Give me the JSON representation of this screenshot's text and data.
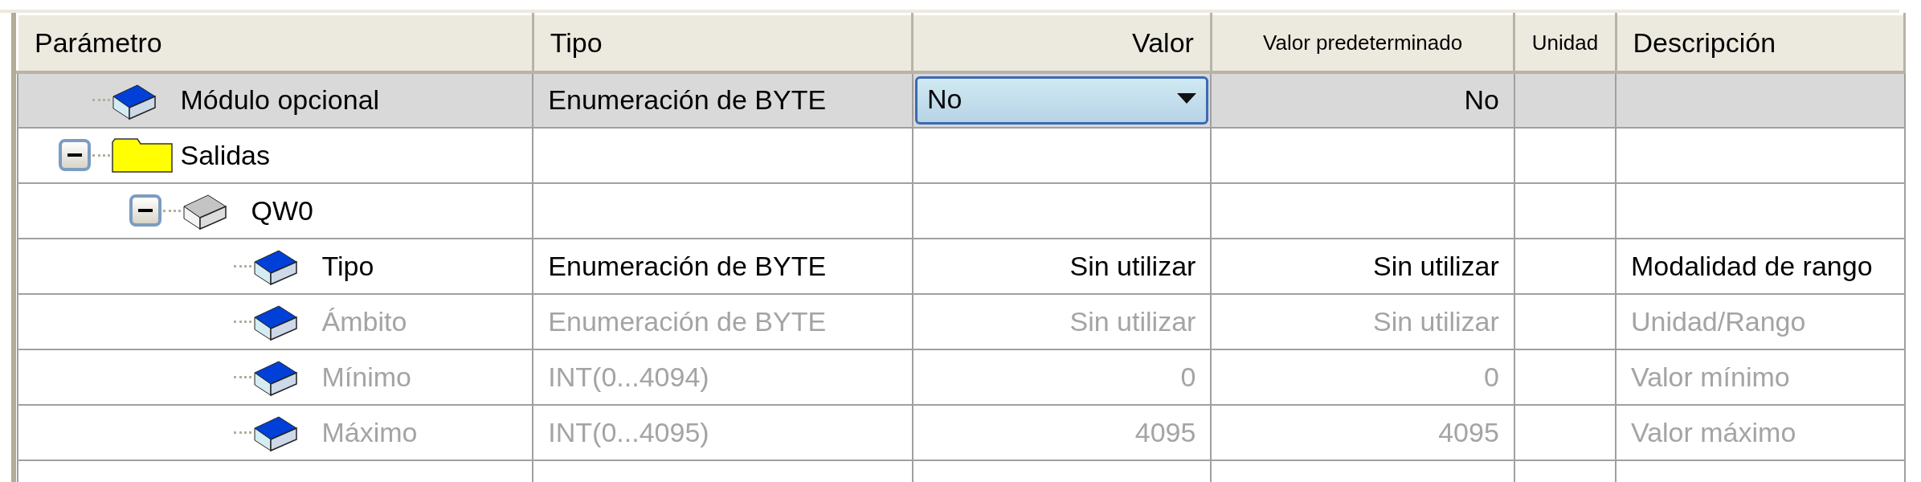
{
  "columns": [
    "Parámetro",
    "Tipo",
    "Valor",
    "Valor predeterminado",
    "Unidad",
    "Descripción"
  ],
  "rows": [
    {
      "parameter": "Módulo opcional",
      "kind": "module",
      "selected": true,
      "disabled": false,
      "type": "Enumeración de BYTE",
      "value": "No",
      "value_dropdown": true,
      "default": "No"
    },
    {
      "parameter": "Salidas",
      "kind": "folder",
      "selected": false,
      "disabled": false,
      "expanded": true,
      "children": [
        {
          "parameter": "QW0",
          "kind": "channel",
          "selected": false,
          "disabled": false,
          "expanded": true,
          "children": [
            {
              "parameter": "Tipo",
              "kind": "module",
              "selected": false,
              "disabled": false,
              "type": "Enumeración de BYTE",
              "value": "Sin utilizar",
              "default": "Sin utilizar",
              "description": "Modalidad de rango"
            },
            {
              "parameter": "Ámbito",
              "kind": "module",
              "selected": false,
              "disabled": true,
              "type": "Enumeración de BYTE",
              "value": "Sin utilizar",
              "default": "Sin utilizar",
              "description": "Unidad/Rango"
            },
            {
              "parameter": "Mínimo",
              "kind": "module",
              "selected": false,
              "disabled": true,
              "type": "INT(0...4094)",
              "value": "0",
              "default": "0",
              "description": "Valor mínimo"
            },
            {
              "parameter": "Máximo",
              "kind": "module",
              "selected": false,
              "disabled": true,
              "type": "INT(0...4095)",
              "value": "4095",
              "default": "4095",
              "description": "Valor máximo"
            }
          ]
        }
      ]
    }
  ]
}
